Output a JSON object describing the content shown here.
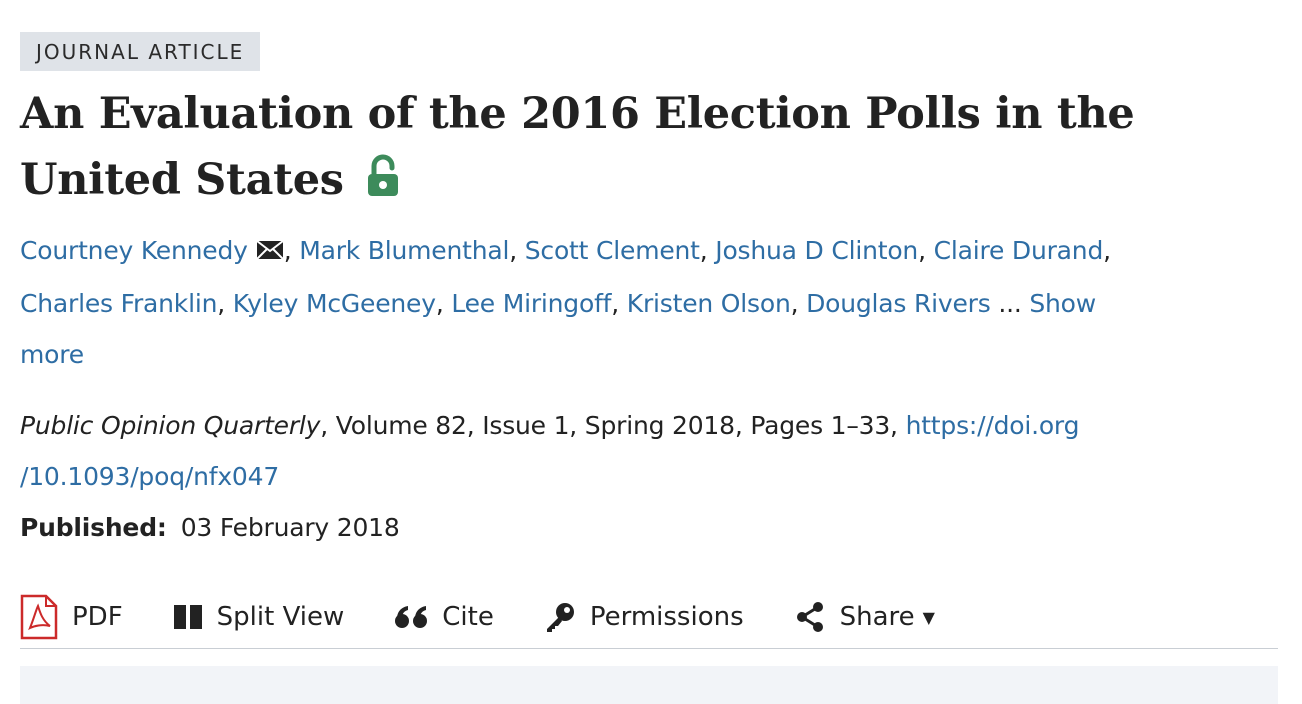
{
  "badge": "JOURNAL ARTICLE",
  "title": {
    "line1": "An Evaluation of the 2016 Election Polls in the",
    "line2": "United States"
  },
  "icons": {
    "open_access": "open-lock-icon",
    "email": "envelope-icon"
  },
  "authors": [
    "Courtney Kennedy",
    "Mark Blumenthal",
    "Scott Clement",
    "Joshua D Clinton",
    "Claire Durand",
    "Charles Franklin",
    "Kyley McGeeney",
    "Lee Miringoff",
    "Kristen Olson",
    "Douglas Rivers"
  ],
  "separator": ",",
  "ellipsis": "...",
  "show_more": {
    "part1": "Show",
    "part2": "more"
  },
  "citation": {
    "journal": "Public Opinion Quarterly",
    "details": ", Volume 82, Issue 1, Spring 2018, Pages 1–33, ",
    "doi_part1": "https://doi.org",
    "doi_part2": "/10.1093/poq/nfx047"
  },
  "published": {
    "label": "Published:",
    "date": "03 February 2018"
  },
  "toolbar": {
    "pdf": "PDF",
    "split_view": "Split View",
    "cite": "Cite",
    "permissions": "Permissions",
    "share": "Share",
    "caret": "▼"
  },
  "colors": {
    "link": "#2e6da4",
    "lock": "#3d8b5b",
    "pdf": "#cc2a2a",
    "badge_bg": "#dfe3e8"
  }
}
